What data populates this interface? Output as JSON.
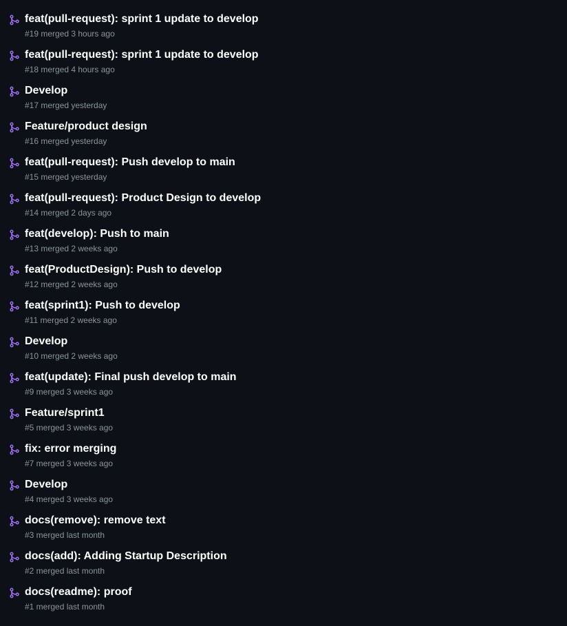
{
  "icon": {
    "name": "git-merge-icon",
    "color": "#a371f7"
  },
  "pull_requests": [
    {
      "title": "feat(pull-request): sprint 1 update to develop",
      "meta": "#19 merged 3 hours ago"
    },
    {
      "title": "feat(pull-request): sprint 1 update to develop",
      "meta": "#18 merged 4 hours ago"
    },
    {
      "title": "Develop",
      "meta": "#17 merged yesterday"
    },
    {
      "title": "Feature/product design",
      "meta": "#16 merged yesterday"
    },
    {
      "title": "feat(pull-request): Push develop to main",
      "meta": "#15 merged yesterday"
    },
    {
      "title": "feat(pull-request): Product Design to develop",
      "meta": "#14 merged 2 days ago"
    },
    {
      "title": "feat(develop): Push to main",
      "meta": "#13 merged 2 weeks ago"
    },
    {
      "title": "feat(ProductDesign): Push to develop",
      "meta": "#12 merged 2 weeks ago"
    },
    {
      "title": "feat(sprint1): Push to develop",
      "meta": "#11 merged 2 weeks ago"
    },
    {
      "title": "Develop",
      "meta": "#10 merged 2 weeks ago"
    },
    {
      "title": "feat(update): Final push develop to main",
      "meta": "#9 merged 3 weeks ago"
    },
    {
      "title": "Feature/sprint1",
      "meta": "#5 merged 3 weeks ago"
    },
    {
      "title": "fix: error merging",
      "meta": "#7 merged 3 weeks ago"
    },
    {
      "title": "Develop",
      "meta": "#4 merged 3 weeks ago"
    },
    {
      "title": "docs(remove): remove text",
      "meta": "#3 merged last month"
    },
    {
      "title": "docs(add): Adding Startup Description",
      "meta": "#2 merged last month"
    },
    {
      "title": "docs(readme): proof",
      "meta": "#1 merged last month"
    }
  ]
}
